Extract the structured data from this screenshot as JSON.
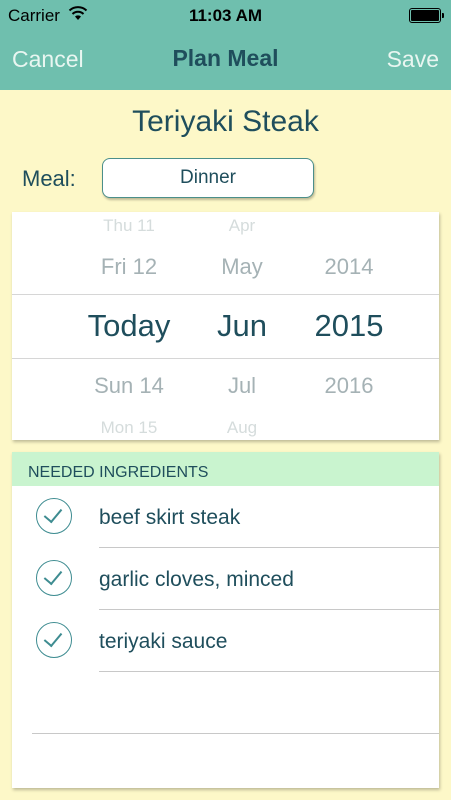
{
  "status_bar": {
    "carrier": "Carrier",
    "time": "11:03 AM",
    "icons": [
      "wifi-icon",
      "battery-icon"
    ]
  },
  "nav": {
    "cancel_label": "Cancel",
    "title": "Plan Meal",
    "save_label": "Save"
  },
  "recipe": {
    "title": "Teriyaki Steak"
  },
  "meal": {
    "label": "Meal:",
    "value": "Dinner"
  },
  "date_picker": {
    "day": {
      "far_above": "Thu 11",
      "above": "Fri 12",
      "selected": "Today",
      "below": "Sun 14",
      "far_below": "Mon 15"
    },
    "month": {
      "far_above": "Apr",
      "above": "May",
      "selected": "Jun",
      "below": "Jul",
      "far_below": "Aug"
    },
    "year": {
      "above": "2014",
      "selected": "2015",
      "below": "2016"
    }
  },
  "ingredients": {
    "header": "NEEDED INGREDIENTS",
    "items": [
      {
        "label": "beef skirt steak",
        "checked": true
      },
      {
        "label": "garlic cloves, minced",
        "checked": true
      },
      {
        "label": "teriyaki sauce",
        "checked": true
      }
    ]
  },
  "colors": {
    "nav_background": "#6fbfae",
    "page_background": "#fdf8c8",
    "accent_text": "#1f4e5c",
    "header_background": "#c9f4cf"
  }
}
